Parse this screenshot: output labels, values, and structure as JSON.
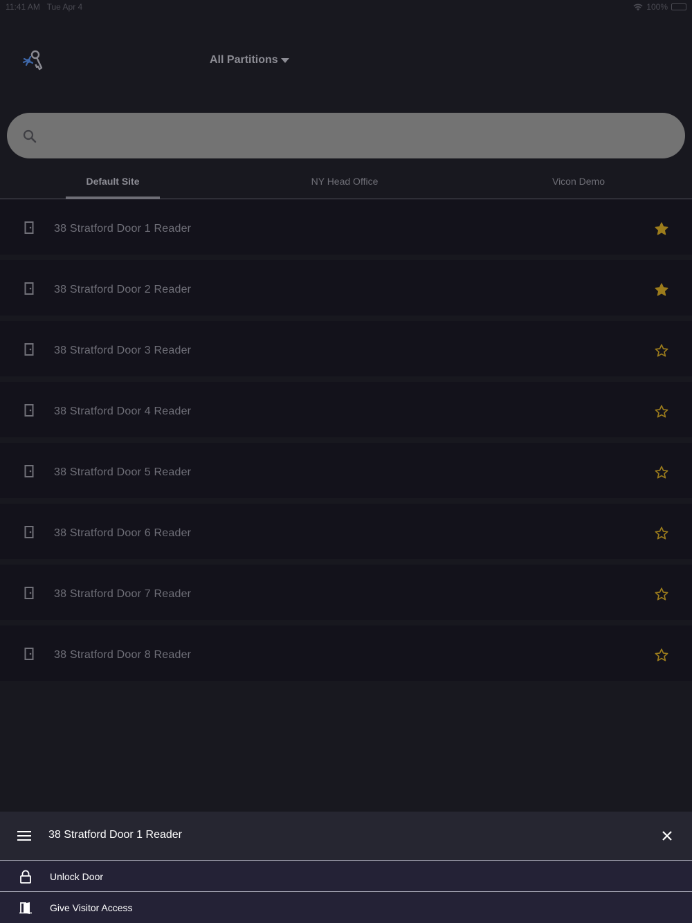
{
  "status_bar": {
    "time": "11:41 AM",
    "date": "Tue Apr 4",
    "battery": "100%",
    "wifi_icon": "wifi-icon",
    "battery_icon": "battery-icon"
  },
  "header": {
    "logo_icon": "keys-icon",
    "partition_label": "All Partitions",
    "partition_icon": "caret-down-icon"
  },
  "search": {
    "icon": "search-icon",
    "value": "",
    "placeholder": ""
  },
  "tabs": [
    {
      "label": "Default Site",
      "active": true
    },
    {
      "label": "NY Head Office",
      "active": false
    },
    {
      "label": "Vicon Demo",
      "active": false
    }
  ],
  "doors": [
    {
      "label": "38 Stratford Door 1 Reader",
      "favorite": true
    },
    {
      "label": "38 Stratford Door 2 Reader",
      "favorite": true
    },
    {
      "label": "38 Stratford Door 3 Reader",
      "favorite": false
    },
    {
      "label": "38 Stratford Door 4 Reader",
      "favorite": false
    },
    {
      "label": "38 Stratford Door 5 Reader",
      "favorite": false
    },
    {
      "label": "38 Stratford Door 6 Reader",
      "favorite": false
    },
    {
      "label": "38 Stratford Door 7 Reader",
      "favorite": false
    },
    {
      "label": "38 Stratford Door 8 Reader",
      "favorite": false
    }
  ],
  "sheet": {
    "title": "38 Stratford Door 1 Reader",
    "menu_icon": "hamburger-menu-icon",
    "close_icon": "close-icon",
    "actions": [
      {
        "label": "Unlock Door",
        "icon": "lock-icon"
      },
      {
        "label": "Give Visitor Access",
        "icon": "visitor-door-icon"
      }
    ]
  },
  "colors": {
    "background": "#18181f",
    "row_background": "#13121b",
    "star": "#9c7c1c",
    "search_bar": "#737373",
    "sheet_background": "#262631",
    "sheet_action_background": "#242236",
    "sheet_text": "#ffffff"
  }
}
